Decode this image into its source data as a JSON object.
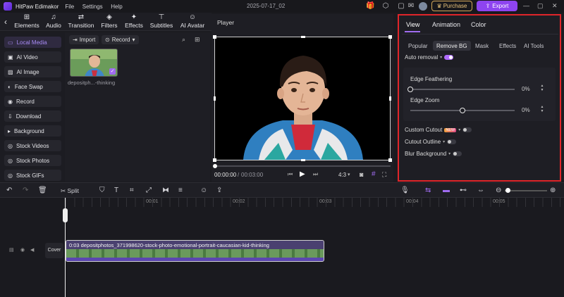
{
  "app": {
    "name": "HitPaw Edimakor",
    "menu": [
      "File",
      "Settings",
      "Help"
    ],
    "project_name": "2025-07-17_02",
    "purchase_label": "Purchase",
    "export_label": "Export"
  },
  "top_tabs": [
    {
      "label": "Elements",
      "icon": "elements-icon"
    },
    {
      "label": "Audio",
      "icon": "music-icon"
    },
    {
      "label": "Transition",
      "icon": "transition-icon"
    },
    {
      "label": "Filters",
      "icon": "filters-icon"
    },
    {
      "label": "Effects",
      "icon": "effects-icon"
    },
    {
      "label": "Subtitles",
      "icon": "subtitles-icon"
    },
    {
      "label": "AI Avatar",
      "icon": "avatar-icon"
    }
  ],
  "sidebar": {
    "items": [
      {
        "label": "Local Media",
        "icon": "folder-icon",
        "active": true
      },
      {
        "label": "AI Video",
        "icon": "ai-video-icon"
      },
      {
        "label": "AI Image",
        "icon": "ai-image-icon"
      },
      {
        "label": "Face Swap",
        "icon": "face-swap-icon"
      },
      {
        "label": "Record",
        "icon": "record-icon"
      },
      {
        "label": "Download",
        "icon": "download-icon"
      },
      {
        "label": "Background",
        "icon": "background-icon"
      },
      {
        "label": "Stock Videos",
        "icon": "stock-videos-icon"
      },
      {
        "label": "Stock Photos",
        "icon": "stock-photos-icon"
      },
      {
        "label": "Stock GIFs",
        "icon": "stock-gifs-icon"
      }
    ]
  },
  "library": {
    "import_label": "Import",
    "record_label": "Record",
    "media_name": "depositph...-thinking"
  },
  "player": {
    "title": "Player",
    "current_time": "00:00:00",
    "total_time": "00:03:00",
    "time_separator": "/",
    "aspect": "4:3"
  },
  "right_panel": {
    "tabs": [
      "View",
      "Animation",
      "Color"
    ],
    "active_tab": "View",
    "subtabs": [
      "Popular",
      "Remove BG",
      "Mask",
      "Effects",
      "AI Tools"
    ],
    "active_subtab": "Remove BG",
    "auto_removal_label": "Auto removal",
    "auto_removal_on": true,
    "edge_feathering": {
      "label": "Edge Feathering",
      "value": "0%",
      "level": 0
    },
    "edge_zoom": {
      "label": "Edge Zoom",
      "value": "0%",
      "level": 0.5
    },
    "custom_cutout_label": "Custom Cutout",
    "new_badge": "NEW",
    "cutout_outline_label": "Cutout Outline",
    "blur_background_label": "Blur Background"
  },
  "toolbar": {
    "split_label": "Split"
  },
  "timeline": {
    "ruler_ticks": [
      "00:01",
      "00:02",
      "00:03",
      "00:04",
      "00:05"
    ],
    "cover_label": "Cover",
    "clip_label": "0:03  depositphotos_371998620-stock-photo-emotional-portrait-caucasian-kid-thinking"
  },
  "colors": {
    "accent": "#8e44f0",
    "highlight_border": "#e0252a",
    "clip": "#5b46b0"
  }
}
